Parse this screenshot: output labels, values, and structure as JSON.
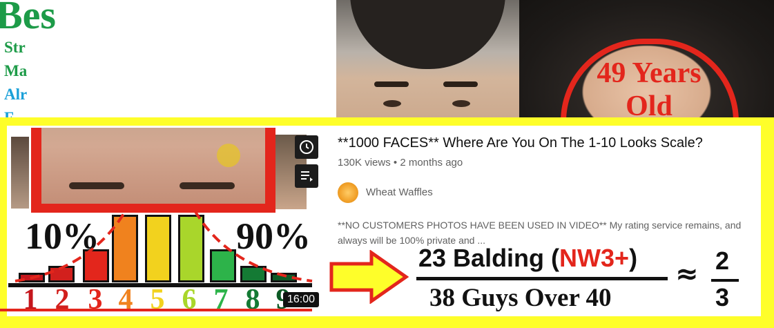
{
  "background": {
    "left_text_big": "Bes",
    "left_lines": [
      {
        "text": "Str",
        "color": "#1d9b48"
      },
      {
        "text": "Ma",
        "color": "#1d9b48"
      },
      {
        "text": "Alr",
        "color": "#1aa0d8"
      },
      {
        "text": "F",
        "color": "#1aa0d8"
      }
    ],
    "age_label_line1": "49 Years",
    "age_label_line2": "Old"
  },
  "thumbnail": {
    "left_percent": "10%",
    "right_percent": "90%",
    "scale_numbers": [
      {
        "n": "1",
        "color": "#c4161c"
      },
      {
        "n": "2",
        "color": "#d2201d"
      },
      {
        "n": "3",
        "color": "#e3261c"
      },
      {
        "n": "4",
        "color": "#f0821e"
      },
      {
        "n": "5",
        "color": "#f2d21e"
      },
      {
        "n": "6",
        "color": "#a9d62b"
      },
      {
        "n": "7",
        "color": "#2db34a"
      },
      {
        "n": "8",
        "color": "#147a34"
      },
      {
        "n": "9",
        "color": "#0d5a25"
      }
    ],
    "duration": "16:00",
    "icons": [
      "clock-icon",
      "add-to-queue-icon"
    ]
  },
  "video": {
    "title": "**1000 FACES** Where Are You On The 1-10 Looks Scale?",
    "views": "130K views",
    "separator": "•",
    "age": "2 months ago",
    "channel": "Wheat Waffles",
    "description_line1": "**NO CUSTOMERS PHOTOS HAVE BEEN USED IN VIDEO** My rating service remains, and",
    "description_line2": "always will be 100% private and ..."
  },
  "formula": {
    "numerator_prefix": "23 Balding (",
    "numerator_highlight": "NW3+",
    "numerator_suffix": ")",
    "denominator": "38 Guys Over 40",
    "approx_symbol": "≈",
    "result_numerator": "2",
    "result_denominator": "3"
  },
  "colors": {
    "card_border": "#fefe2a",
    "accent_red": "#e3261c"
  }
}
